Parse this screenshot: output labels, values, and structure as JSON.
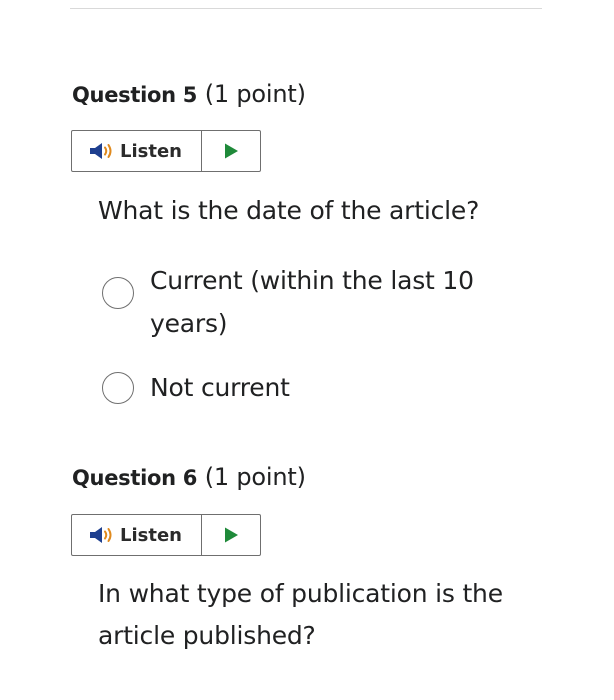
{
  "questions": [
    {
      "number_label": "Question 5",
      "points_label": "(1 point)",
      "listen_label": "Listen",
      "text": "What is the date of the article?",
      "options": [
        {
          "label": "Current (within the last 10 years)",
          "selected": false
        },
        {
          "label": "Not current",
          "selected": false
        }
      ]
    },
    {
      "number_label": "Question 6",
      "points_label": "(1 point)",
      "listen_label": "Listen",
      "text": "In what type of publication is the article published?"
    }
  ],
  "icons": {
    "speaker": "speaker-icon",
    "play": "play-icon"
  },
  "colors": {
    "text": "#202122",
    "border": "#6f6f6f",
    "play_accent": "#1f8a3a",
    "speaker_body": "#1e3f8f",
    "speaker_waves": "#e08a1e"
  }
}
